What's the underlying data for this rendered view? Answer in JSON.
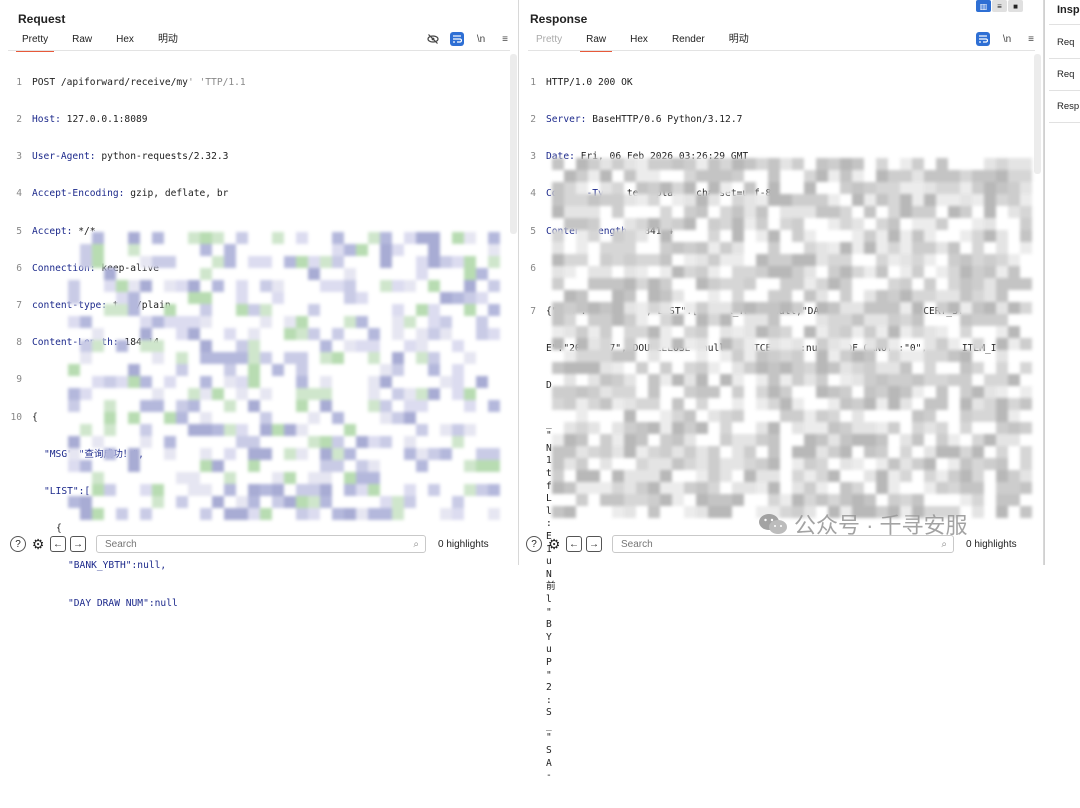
{
  "request": {
    "title": "Request",
    "tabs": [
      "Pretty",
      "Raw",
      "Hex",
      "明动"
    ],
    "active_tab": "Pretty",
    "toolbar": [
      "eye-off-icon",
      "wrap-icon",
      "\\n",
      "menu-icon"
    ],
    "lines": [
      {
        "n": "1",
        "text": "POST /apiforward/receive/my",
        "tail": "' 'TTP/1.1"
      },
      {
        "n": "2",
        "key": "Host:",
        "val": " 127.0.0.1:8089"
      },
      {
        "n": "3",
        "key": "User-Agent:",
        "val": " python-requests/2.32.3"
      },
      {
        "n": "4",
        "key": "Accept-Encoding:",
        "val": " gzip, deflate, br"
      },
      {
        "n": "5",
        "key": "Accept:",
        "val": " */*"
      },
      {
        "n": "6",
        "key": "Connection:",
        "val": " keep-alive"
      },
      {
        "n": "7",
        "key": "content-type:",
        "val": " text/plain"
      },
      {
        "n": "8",
        "key": "Content-Length:",
        "val": " 184114"
      },
      {
        "n": "9",
        "text": ""
      },
      {
        "n": "10",
        "text": "{"
      }
    ],
    "json_lines": [
      "\"MSG\":\"查询成功！\",",
      "\"LIST\":[",
      "{",
      "\"BANK_YBTH\":null,",
      "\"DAY_DRAW_NUM\":null"
    ],
    "search_placeholder": "Search",
    "highlights": "0 highlights"
  },
  "response": {
    "title": "Response",
    "tabs": [
      "Pretty",
      "Raw",
      "Hex",
      "Render",
      "明动"
    ],
    "active_tab": "Raw",
    "toolbar": [
      "wrap-icon",
      "\\n",
      "menu-icon"
    ],
    "lines": [
      {
        "n": "1",
        "text": "HTTP/1.0 200 OK"
      },
      {
        "n": "2",
        "key": "Server:",
        "val": " BaseHTTP/0.6 Python/3.12.7"
      },
      {
        "n": "3",
        "key": "Date:",
        "val": " Fri, 06 Feb 2026 03:26:29 GMT"
      },
      {
        "n": "4",
        "key": "Content-Type:",
        "val": " text/plain; charset=utf-8"
      },
      {
        "n": "5",
        "key": "Content-Length:",
        "val": " 184114"
      },
      {
        "n": "6",
        "text": ""
      },
      {
        "n": "7",
        "text": "{\"MSG\":\"查询成功！\",\"LIST\":[{\"BANK_YBTH\":null,\"DAY_DRAW_NUM\":null,\"CERT_STAR_DAT"
      }
    ],
    "wrap_lines": [
      "E\":\"20230627\",\"DOUBLELOSE\":null,\"AGNTCERNUM\":null,\"PDF_ORNOT\":\"0\",\"WORK_ITEM_I",
      "D"
    ],
    "left_chars": [
      "_",
      "\"",
      "N",
      "1",
      "t",
      "f",
      "L",
      "l",
      ":",
      "E",
      "1",
      "u",
      "N",
      "前",
      "l",
      "\"",
      "B",
      "Y",
      "u",
      "P",
      "\"",
      "2",
      ":",
      "S",
      "_",
      "\"",
      "S",
      "A",
      "-"
    ],
    "search_placeholder": "Search",
    "highlights": "0 highlights"
  },
  "inspector": {
    "title": "Insp",
    "items": [
      "Req",
      "Req",
      "Resp"
    ]
  },
  "watermark": "公众号 · 千寻安服"
}
